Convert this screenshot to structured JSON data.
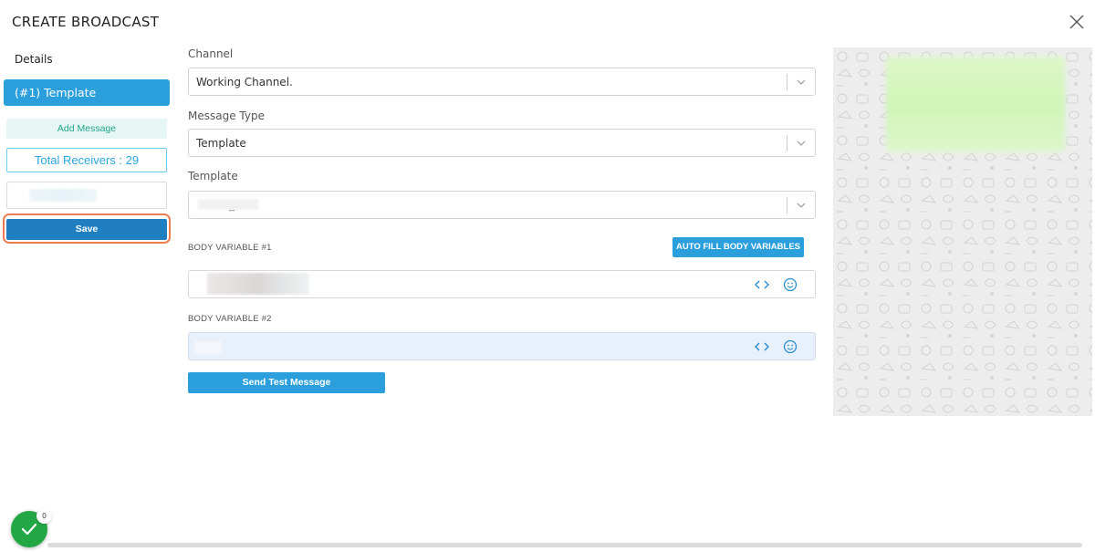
{
  "header": {
    "title": "CREATE BROADCAST"
  },
  "sidebar": {
    "details_label": "Details",
    "template_tab_label": "(#1) Template",
    "add_message_label": "Add Message",
    "total_receivers_label": "Total Receivers : 29",
    "save_label": "Save"
  },
  "form": {
    "channel": {
      "label": "Channel",
      "value": "Working Channel."
    },
    "message_type": {
      "label": "Message Type",
      "value": "Template"
    },
    "template": {
      "label": "Template",
      "value": "_"
    },
    "body_variable_1": {
      "label": "BODY VARIABLE #1"
    },
    "body_variable_2": {
      "label": "BODY VARIABLE #2"
    },
    "auto_fill_label": "AUTO FILL BODY VARIABLES",
    "send_test_label": "Send Test Message"
  },
  "status": {
    "badge_count": "0",
    "color": "#22a744"
  },
  "colors": {
    "primary": "#2a9fdc",
    "save": "#1f7fc0",
    "highlight_ring": "#ee7c52",
    "add_message_text": "#21a68a"
  }
}
